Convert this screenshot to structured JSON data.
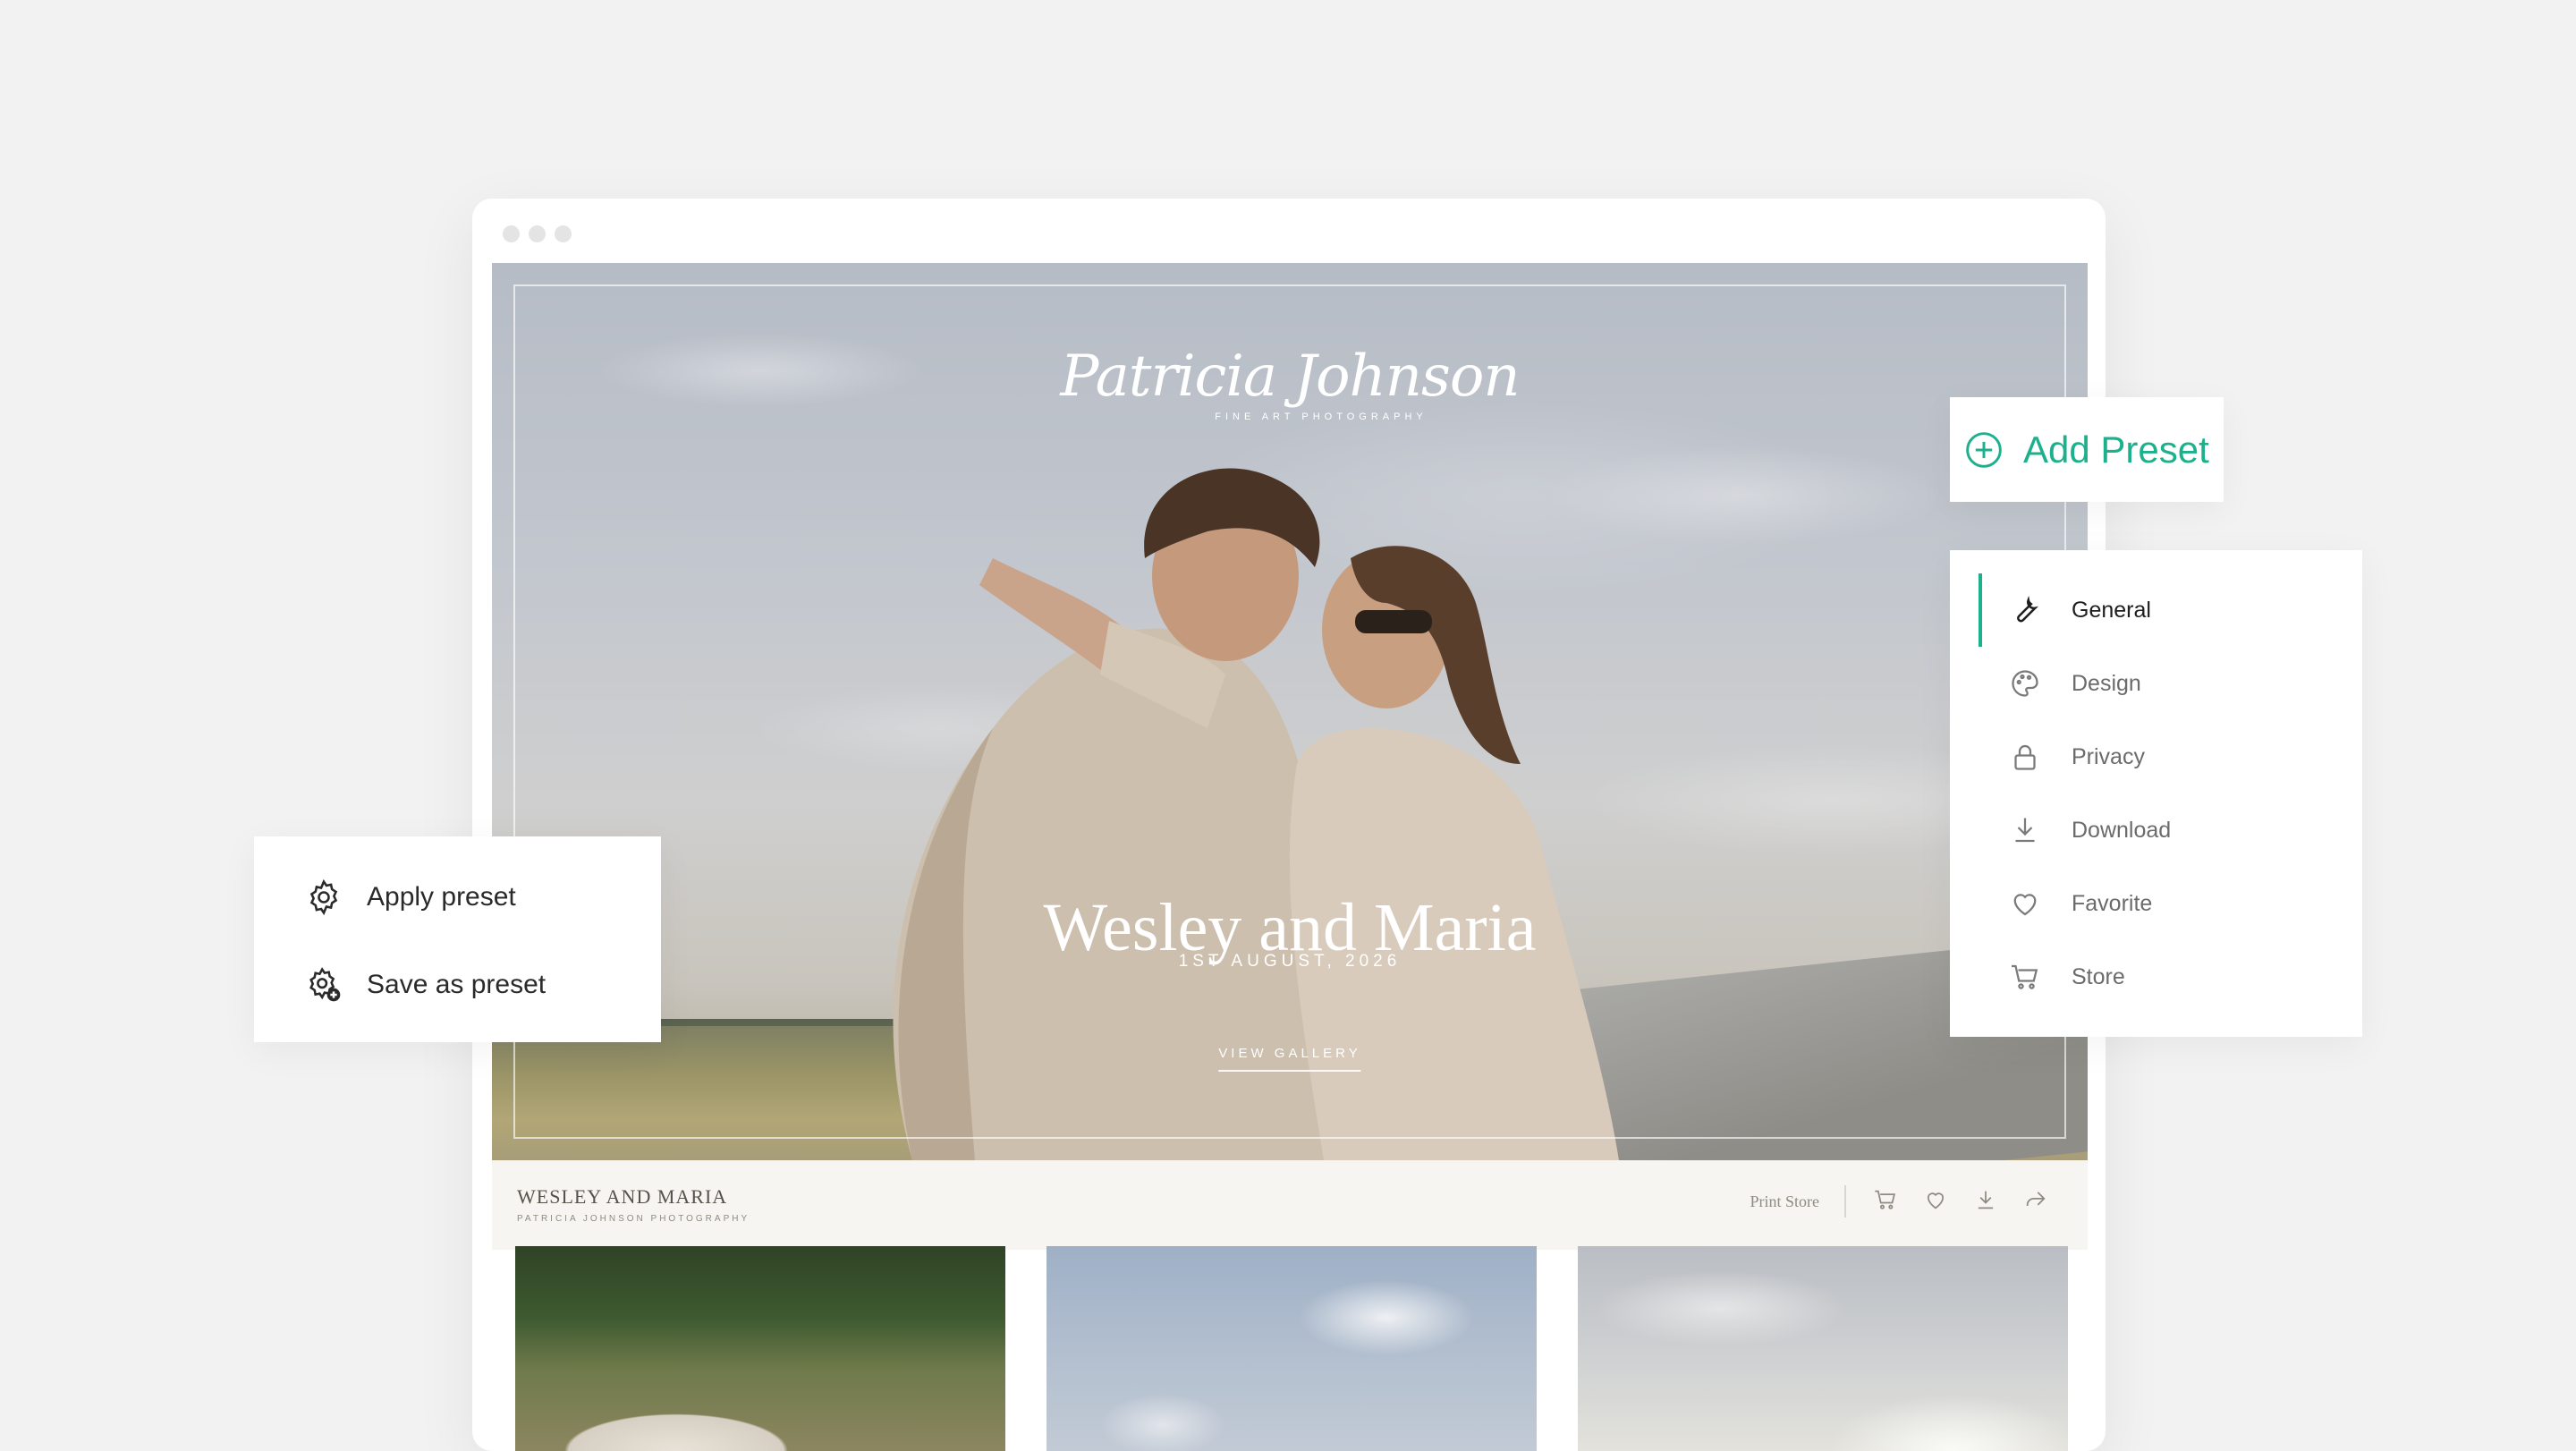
{
  "hero": {
    "logo_script": "Patricia Johnson",
    "logo_sub": "FINE ART     PHOTOGRAPHY",
    "title": "Wesley and Maria",
    "date": "1ST AUGUST, 2026",
    "link": "VIEW GALLERY"
  },
  "gallery": {
    "title": "WESLEY AND MARIA",
    "subtitle": "PATRICIA JOHNSON PHOTOGRAPHY",
    "print_store": "Print Store",
    "icons": [
      "cart-icon",
      "heart-icon",
      "download-icon",
      "share-icon"
    ]
  },
  "add_preset": {
    "label": "Add Preset",
    "icon": "plus-circle-icon"
  },
  "settings_menu": {
    "items": [
      {
        "label": "General",
        "icon": "wrench-icon",
        "active": true
      },
      {
        "label": "Design",
        "icon": "palette-icon",
        "active": false
      },
      {
        "label": "Privacy",
        "icon": "lock-icon",
        "active": false
      },
      {
        "label": "Download",
        "icon": "download-icon",
        "active": false
      },
      {
        "label": "Favorite",
        "icon": "heart-icon",
        "active": false
      },
      {
        "label": "Store",
        "icon": "cart-icon",
        "active": false
      }
    ]
  },
  "preset_menu": {
    "items": [
      {
        "label": "Apply preset",
        "icon": "gear-icon"
      },
      {
        "label": "Save as preset",
        "icon": "gear-plus-icon"
      }
    ]
  },
  "colors": {
    "accent": "#1cb08d",
    "background": "#f2f2f2",
    "gallery_bar": "#f6f5f1"
  }
}
